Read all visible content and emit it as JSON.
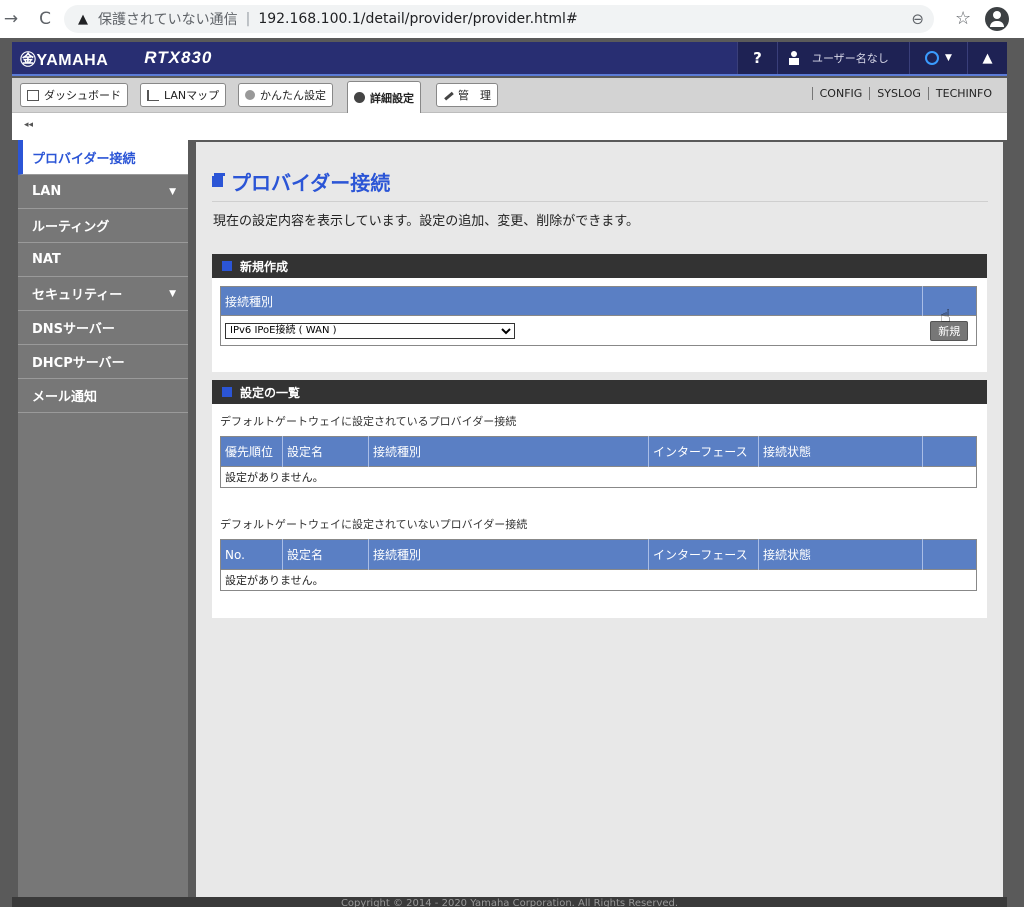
{
  "browser": {
    "back": "→",
    "reload": "C",
    "warning_icon": "▲",
    "insecure_label": "保護されていない通信",
    "url": "192.168.100.1/detail/provider/provider.html#",
    "zoom_icon": "⊖",
    "star_icon": "☆"
  },
  "header": {
    "logo": "㊎YAMAHA",
    "model": "RTX830",
    "help": "?",
    "user": "ユーザー名なし",
    "bell": "▲"
  },
  "menu": {
    "tabs": [
      {
        "label": "ダッシュボード"
      },
      {
        "label": "LANマップ"
      },
      {
        "label": "かんたん設定"
      },
      {
        "label": "詳細設定"
      },
      {
        "label": "管　理"
      }
    ],
    "links": [
      "CONFIG",
      "SYSLOG",
      "TECHINFO"
    ]
  },
  "collapse": "◂◂",
  "sidebar": {
    "items": [
      {
        "label": "プロバイダー接続"
      },
      {
        "label": "LAN",
        "caret": "▼"
      },
      {
        "label": "ルーティング"
      },
      {
        "label": "NAT"
      },
      {
        "label": "セキュリティー",
        "caret": "▼"
      },
      {
        "label": "DNSサーバー"
      },
      {
        "label": "DHCPサーバー"
      },
      {
        "label": "メール通知"
      }
    ]
  },
  "main": {
    "title": "プロバイダー接続",
    "description": "現在の設定内容を表示しています。設定の追加、変更、削除ができます。",
    "new_section": {
      "heading": "新規作成",
      "column": "接続種別",
      "selected": "IPv6 IPoE接続 ( WAN )",
      "button": "新規"
    },
    "list_section": {
      "heading": "設定の一覧",
      "default_caption": "デフォルトゲートウェイに設定されているプロバイダー接続",
      "default_columns": [
        "優先順位",
        "設定名",
        "接続種別",
        "インターフェース",
        "接続状態",
        ""
      ],
      "default_empty": "設定がありません。",
      "other_caption": "デフォルトゲートウェイに設定されていないプロバイダー接続",
      "other_columns": [
        "No.",
        "設定名",
        "接続種別",
        "インターフェース",
        "接続状態",
        ""
      ],
      "other_empty": "設定がありません。"
    }
  },
  "footer": "Copyright © 2014 - 2020 Yamaha Corporation. All Rights Reserved."
}
